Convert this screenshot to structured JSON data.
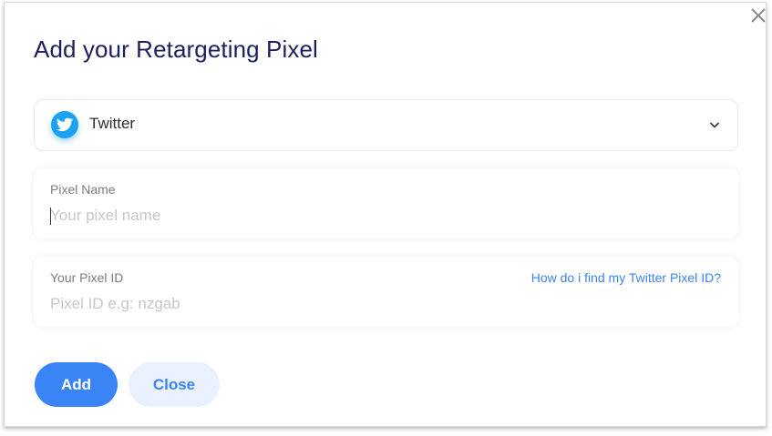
{
  "dialog": {
    "title": "Add your Retargeting Pixel",
    "close_icon": "close-x-icon"
  },
  "platform_select": {
    "icon": "twitter-bird-icon",
    "selected": "Twitter",
    "chevron_icon": "chevron-down-icon",
    "brand_color": "#1DA1F2"
  },
  "pixel_name": {
    "label": "Pixel Name",
    "value": "",
    "placeholder": "Your pixel name"
  },
  "pixel_id": {
    "label": "Your Pixel ID",
    "value": "",
    "placeholder": "Pixel ID e.g: nzgab",
    "help_link": "How do i find my Twitter Pixel ID?"
  },
  "buttons": {
    "add": "Add",
    "close": "Close"
  },
  "colors": {
    "primary": "#3A84F5",
    "title": "#1C1F5E",
    "secondary_button_bg": "#E8F1FD"
  }
}
